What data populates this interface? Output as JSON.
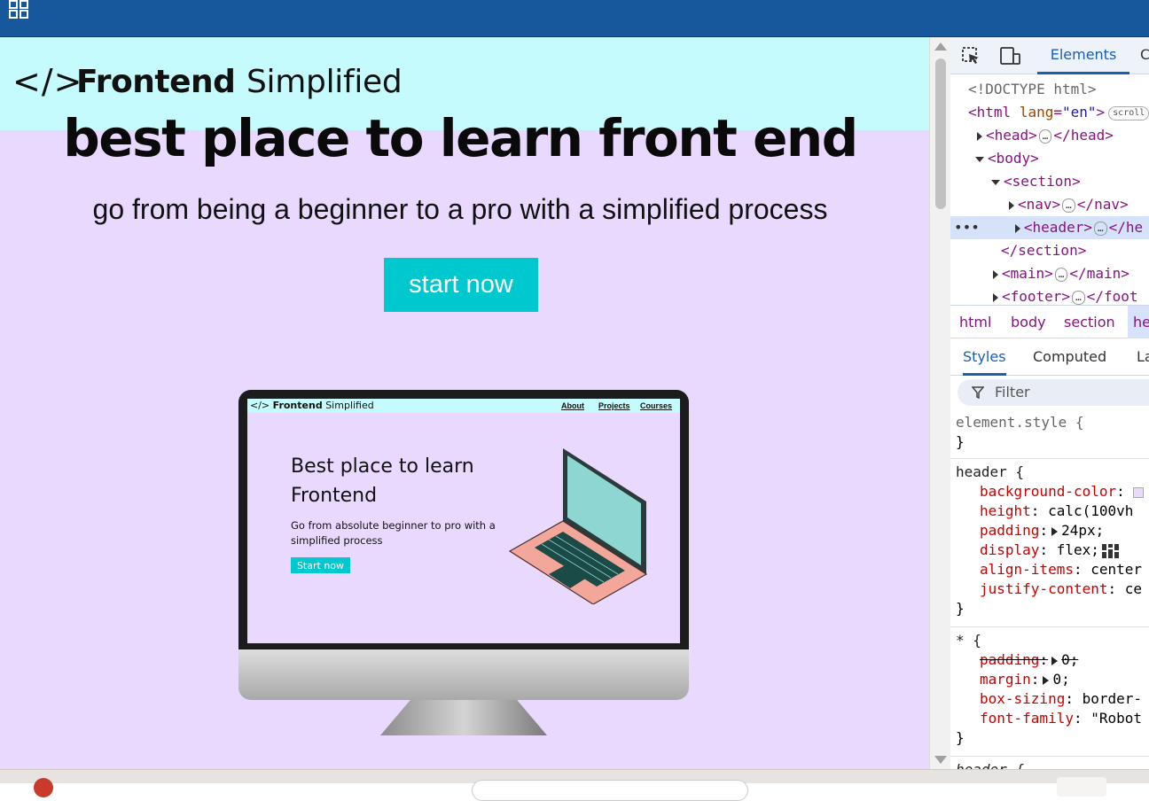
{
  "colors": {
    "topbar": "#17579b",
    "nav_bg": "#c5fbfc",
    "page_bg": "#e9d9fe",
    "button_bg": "#00c8cf",
    "devtools_accent": "#1a5fb4"
  },
  "site": {
    "logo_code": "</>",
    "logo_bold": "Frontend",
    "logo_light": "Simplified",
    "hero_title": "best place to learn front end",
    "hero_subtitle": "go from being a beginner to a pro with a simplified process",
    "start_button": "start now"
  },
  "mockup": {
    "logo_code": "</>",
    "logo_bold": "Frontend",
    "logo_light": "Simplified",
    "links": [
      "About",
      "Projects",
      "Courses"
    ],
    "title": "Best place to learn Frontend",
    "subtitle": "Go from absolute beginner to pro with a simplified process",
    "button": "Start now"
  },
  "devtools": {
    "tab_elements": "Elements",
    "tab_more": "C",
    "tree": {
      "doctype": "<!DOCTYPE html>",
      "html_open": "<html",
      "html_attr": "lang",
      "html_val": "\"en\"",
      "html_close": ">",
      "scroll_pill": "scroll",
      "head_open": "<head>",
      "head_close": "</head>",
      "body": "<body>",
      "section": "<section>",
      "nav_open": "<nav>",
      "nav_close": "</nav>",
      "header_open": "<header>",
      "header_close": "</he",
      "section_close": "</section>",
      "main_open": "<main>",
      "main_close": "</main>",
      "footer_open": "<footer>",
      "footer_close": "</foot",
      "ellipsis": "…",
      "row_dots": "•••"
    },
    "breadcrumbs": [
      "html",
      "body",
      "section",
      "he"
    ],
    "subtabs": [
      "Styles",
      "Computed",
      "La"
    ],
    "filter_placeholder": "Filter",
    "styles": {
      "element_style_selector": "element.style {",
      "close_brace": "}",
      "header_selector": "header {",
      "header_props": [
        {
          "name": "background-color",
          "value": ""
        },
        {
          "name": "height",
          "value": "calc(100vh"
        },
        {
          "name": "padding",
          "value": "24px;"
        },
        {
          "name": "display",
          "value": "flex;"
        },
        {
          "name": "align-items",
          "value": "center"
        },
        {
          "name": "justify-content",
          "value": "ce"
        }
      ],
      "star_selector": "* {",
      "star_props": [
        {
          "name": "padding",
          "value": "0;"
        },
        {
          "name": "margin",
          "value": "0;"
        },
        {
          "name": "box-sizing",
          "value": "border-"
        },
        {
          "name": "font-family",
          "value": "\"Robot"
        }
      ],
      "next_selector": "header {"
    }
  },
  "icons": [
    "grid-icon",
    "inspect-icon",
    "device-toolbar-icon",
    "flex-editor-icon",
    "filter-icon",
    "scroll-up-arrow-icon",
    "scroll-down-arrow-icon"
  ]
}
